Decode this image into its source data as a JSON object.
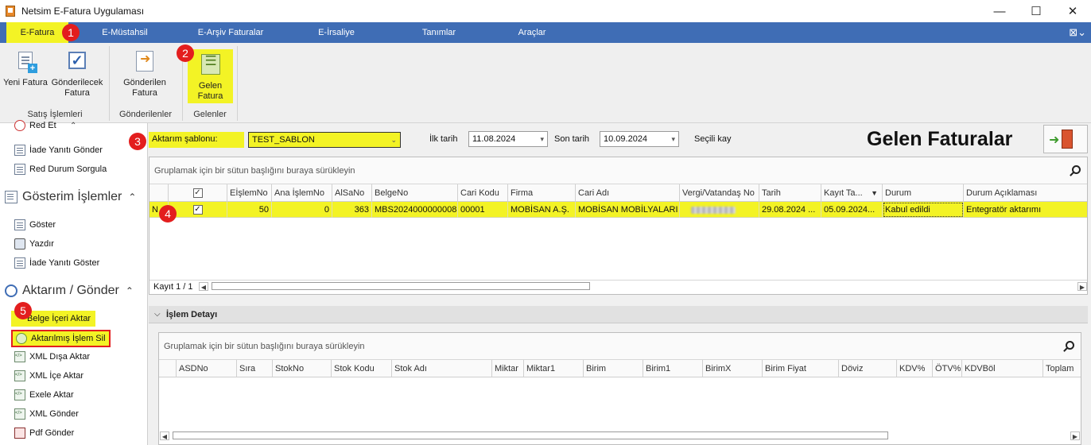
{
  "window": {
    "title": "Netsim E-Fatura Uygulaması",
    "minimize": "—",
    "maximize": "☐",
    "close": "✕"
  },
  "menu": {
    "tabs": [
      "E-Fatura",
      "E-Müstahsil",
      "E-Arşiv Faturalar",
      "E-İrsaliye",
      "Tanımlar",
      "Araçlar"
    ],
    "active": "E-Fatura",
    "right_icon": "⊠⌄"
  },
  "ribbon": {
    "buttons": [
      {
        "label": "Yeni Fatura",
        "icon": "new-invoice-icon"
      },
      {
        "label": "Gönderilecek Fatura",
        "icon": "checkbox-icon"
      },
      {
        "label": "Gönderilen Fatura",
        "icon": "sent-document-icon"
      },
      {
        "label": "Gelen Fatura",
        "icon": "incoming-list-icon"
      }
    ],
    "groups": [
      "Satış İşlemleri",
      "Gönderilenler",
      "Gelenler"
    ]
  },
  "markers": [
    "1",
    "2",
    "3",
    "4",
    "5"
  ],
  "left_panel": {
    "partial_item": "Red Et",
    "items_top": [
      "İade Yanıtı Gönder",
      "Red Durum Sorgula"
    ],
    "section_view": "Gösterim İşlemler",
    "view_items": [
      "Göster",
      "Yazdır",
      "İade Yanıtı Göster"
    ],
    "section_transfer": "Aktarım / Gönder",
    "transfer_items": [
      "Belge İçeri Aktar",
      "Aktarılmış İşlem Sil",
      "XML Dışa Aktar",
      "XML İçe Aktar",
      "Exele Aktar",
      "XML Gönder",
      "Pdf Gönder"
    ],
    "caret_up": "⌃"
  },
  "filter": {
    "template_label": "Aktarım şablonu:",
    "template_value": "TEST_SABLON",
    "start_label": "İlk tarih",
    "start_value": "11.08.2024",
    "end_label": "Son tarih",
    "end_value": "10.09.2024",
    "selected_label": "Seçili kay"
  },
  "page_title": "Gelen Faturalar",
  "invoices_grid": {
    "group_hint": "Gruplamak için bir sütun başlığını buraya sürükleyin",
    "columns": [
      "EİşlemNo",
      "Ana İşlemNo",
      "AlSaNo",
      "BelgeNo",
      "Cari Kodu",
      "Firma",
      "Cari Adı",
      "Vergi/Vatandaş No",
      "Tarih",
      "Kayıt Ta...",
      "Durum",
      "Durum Açıklaması"
    ],
    "header_check": "✓",
    "sort_indicator": "▼",
    "rows": [
      {
        "row_marker": "N",
        "checked": "✓",
        "eislem_no": "50",
        "ana_islem_no": "0",
        "alsa_no": "363",
        "belge_no": "MBS2024000000008",
        "cari_kodu": "00001",
        "firma": "MOBİSAN A.Ş.",
        "cari_adi": "MOBİSAN MOBİLYALARI",
        "tarih": "29.08.2024 ...",
        "kayit_tarihi": "05.09.2024...",
        "durum": "Kabul edildi",
        "durum_aciklamasi": "Entegratör aktarımı"
      }
    ],
    "record_count": "Kayıt 1 / 1"
  },
  "detail": {
    "title": "İşlem Detayı",
    "group_hint": "Gruplamak için bir sütun başlığını buraya sürükleyin",
    "columns": [
      "ASDNo",
      "Sıra",
      "StokNo",
      "Stok Kodu",
      "Stok Adı",
      "Miktar",
      "Miktar1",
      "Birim",
      "Birim1",
      "BirimX",
      "Birim Fiyat",
      "Döviz",
      "KDV%",
      "ÖTV%",
      "KDVBöl",
      "Toplam"
    ]
  },
  "colors": {
    "menu_blue": "#3f6db5",
    "highlight_yellow": "#f3f325",
    "marker_red": "#e31e1e"
  }
}
